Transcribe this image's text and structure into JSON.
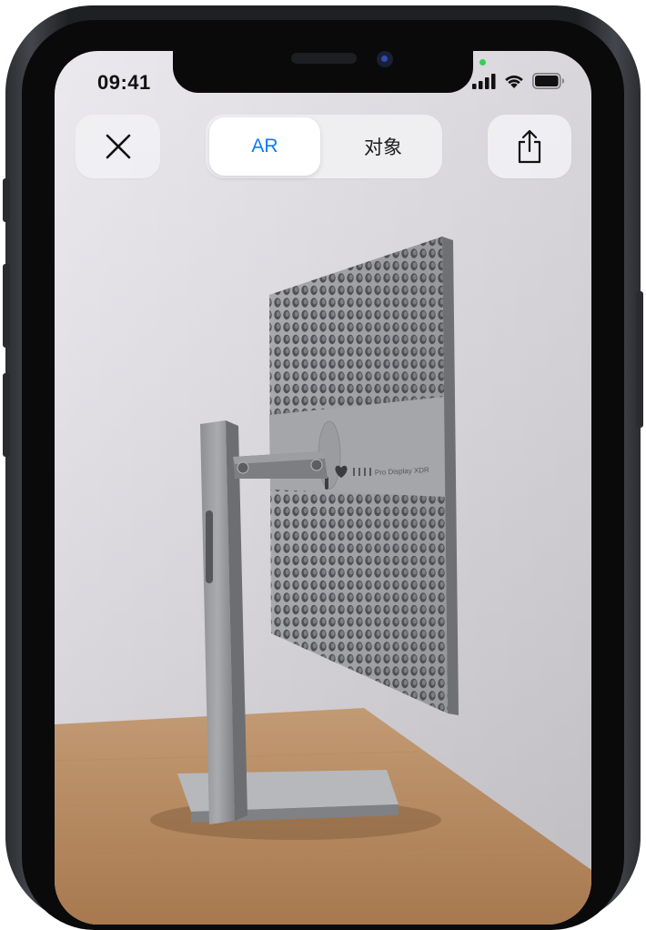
{
  "status_bar": {
    "time": "09:41"
  },
  "toolbar": {
    "close_icon": "close-icon",
    "share_icon": "share-icon",
    "segments": [
      {
        "label": "AR",
        "selected": true
      },
      {
        "label": "对象",
        "selected": false
      }
    ]
  },
  "ar_object": {
    "model_label": "Pro Display XDR",
    "logo_icon": "apple-logo-icon"
  },
  "colors": {
    "accent": "#0a7aff",
    "control_bg": "#f0f0f3",
    "privacy_indicator": "#30d158"
  }
}
